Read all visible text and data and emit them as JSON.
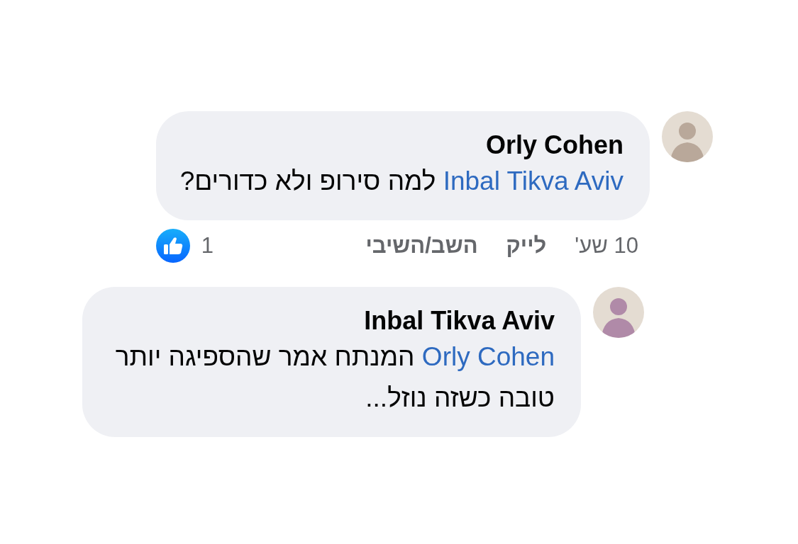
{
  "comments": [
    {
      "author": "Orly Cohen",
      "mention": "Inbal Tikva Aviv",
      "text": "למה סירופ ולא כדורים?",
      "time": "10 שע'",
      "actions": [
        "לייק",
        "השב/השיבי"
      ],
      "like_count": "1",
      "replies": [
        {
          "author": "Inbal Tikva Aviv",
          "mention": "Orly Cohen",
          "text": "המנתח אמר שהספיגה יותר טובה כשזה נוזל..."
        }
      ]
    }
  ]
}
